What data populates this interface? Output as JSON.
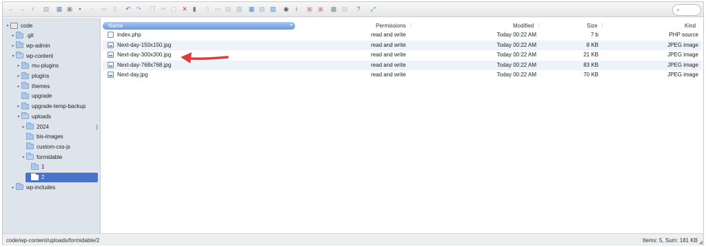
{
  "toolbar": {
    "buttons": [
      {
        "name": "back-icon",
        "glyph": "←",
        "color": "#7aa6d8"
      },
      {
        "name": "forward-icon",
        "glyph": "→",
        "color": "#7aa6d8"
      },
      {
        "name": "up-icon",
        "glyph": "↑",
        "color": "#4a86c8"
      },
      {
        "name": "reload-icon",
        "glyph": "▤",
        "color": "#9aa3ad"
      },
      {
        "name": "open-icon",
        "glyph": "▦",
        "color": "#6b8bb0"
      },
      {
        "name": "download-icon",
        "glyph": "▣",
        "color": "#7f9f7f"
      },
      {
        "name": "save-icon",
        "glyph": "▪",
        "color": "#5f6f80"
      },
      {
        "name": "new-folder-icon",
        "glyph": "▫",
        "color": "#b0b8c0"
      },
      {
        "name": "new-file-icon",
        "glyph": "▭",
        "color": "#b0b8c0"
      },
      {
        "name": "upload-icon",
        "glyph": "▯",
        "color": "#b0b8c0"
      },
      {
        "name": "undo-icon",
        "glyph": "↶",
        "color": "#4f7fb8"
      },
      {
        "name": "redo-icon",
        "glyph": "↷",
        "color": "#9aa6b2"
      },
      {
        "name": "copy-icon",
        "glyph": "❐",
        "color": "#b7c2cc"
      },
      {
        "name": "cut-icon",
        "glyph": "✂",
        "color": "#b7c2cc"
      },
      {
        "name": "paste-icon",
        "glyph": "▢",
        "color": "#b7c2cc"
      },
      {
        "name": "delete-icon",
        "glyph": "✕",
        "color": "#d04040"
      },
      {
        "name": "empty-icon",
        "glyph": "▮",
        "color": "#6f7a86"
      },
      {
        "name": "duplicate-icon",
        "glyph": "▯",
        "color": "#b7c2cc"
      },
      {
        "name": "rename-icon",
        "glyph": "▭",
        "color": "#b7c2cc"
      },
      {
        "name": "edit-icon",
        "glyph": "▤",
        "color": "#b7c2cc"
      },
      {
        "name": "archive-icon",
        "glyph": "▧",
        "color": "#9fb3c8"
      },
      {
        "name": "icons-view-icon",
        "glyph": "▦",
        "color": "#4f86c6"
      },
      {
        "name": "list-view-icon",
        "glyph": "▤",
        "color": "#9fb3c8"
      },
      {
        "name": "resize-icon",
        "glyph": "▨",
        "color": "#4f86c6"
      },
      {
        "name": "preview-icon",
        "glyph": "◉",
        "color": "#555555"
      },
      {
        "name": "info-icon",
        "glyph": "i",
        "color": "#3a78c8"
      },
      {
        "name": "extract-icon",
        "glyph": "▣",
        "color": "#c8a0a0"
      },
      {
        "name": "compress-icon",
        "glyph": "▣",
        "color": "#c8a0a0"
      },
      {
        "name": "grid-icon",
        "glyph": "▩",
        "color": "#808890"
      },
      {
        "name": "sort-icon",
        "glyph": "▤",
        "color": "#b7c2cc"
      },
      {
        "name": "help-icon",
        "glyph": "?",
        "color": "#3a78c8"
      },
      {
        "name": "fullscreen-icon",
        "glyph": "⤢",
        "color": "#3aa060"
      }
    ],
    "search_glyph": "⌕"
  },
  "tree": {
    "items": [
      {
        "label": "code",
        "level": 0,
        "arrow": "▾",
        "icon": "drive",
        "selected": false
      },
      {
        "label": ".git",
        "level": 1,
        "arrow": "▸",
        "icon": "folder",
        "selected": false
      },
      {
        "label": "wp-admin",
        "level": 1,
        "arrow": "▸",
        "icon": "folder",
        "selected": false
      },
      {
        "label": "wp-content",
        "level": 1,
        "arrow": "▾",
        "icon": "folder-open",
        "selected": false
      },
      {
        "label": "mu-plugins",
        "level": 2,
        "arrow": "▸",
        "icon": "folder",
        "selected": false
      },
      {
        "label": "plugins",
        "level": 2,
        "arrow": "▸",
        "icon": "folder",
        "selected": false
      },
      {
        "label": "themes",
        "level": 2,
        "arrow": "▸",
        "icon": "folder",
        "selected": false
      },
      {
        "label": "upgrade",
        "level": 2,
        "arrow": "",
        "icon": "folder",
        "selected": false
      },
      {
        "label": "upgrade-temp-backup",
        "level": 2,
        "arrow": "▸",
        "icon": "folder",
        "selected": false
      },
      {
        "label": "uploads",
        "level": 2,
        "arrow": "▾",
        "icon": "folder-open",
        "selected": false
      },
      {
        "label": "2024",
        "level": 3,
        "arrow": "▸",
        "icon": "folder",
        "selected": false
      },
      {
        "label": "bis-images",
        "level": 3,
        "arrow": "",
        "icon": "folder",
        "selected": false
      },
      {
        "label": "custom-css-js",
        "level": 3,
        "arrow": "",
        "icon": "folder",
        "selected": false
      },
      {
        "label": "formidable",
        "level": 3,
        "arrow": "▾",
        "icon": "folder-open",
        "selected": false
      },
      {
        "label": "1",
        "level": 4,
        "arrow": "",
        "icon": "folder",
        "selected": false
      },
      {
        "label": "2",
        "level": 4,
        "arrow": "",
        "icon": "folder",
        "selected": true
      },
      {
        "label": "wp-includes",
        "level": 1,
        "arrow": "▸",
        "icon": "folder",
        "selected": false
      }
    ]
  },
  "list": {
    "headers": {
      "name": "Name",
      "permissions": "Permissions",
      "modified": "Modified",
      "size": "Size",
      "kind": "Kind"
    },
    "sort_glyph": "▾",
    "sep_glyph": "⁞",
    "rows": [
      {
        "name": "index.php",
        "permissions": "read and write",
        "modified": "Today 00:22 AM",
        "size": "7 b",
        "kind": "PHP source",
        "type": "php"
      },
      {
        "name": "Next-day-150x150.jpg",
        "permissions": "read and write",
        "modified": "Today 00:22 AM",
        "size": "8 KB",
        "kind": "JPEG image",
        "type": "img"
      },
      {
        "name": "Next-day-300x300.jpg",
        "permissions": "read and write",
        "modified": "Today 00:22 AM",
        "size": "21 KB",
        "kind": "JPEG image",
        "type": "img"
      },
      {
        "name": "Next-day-768x768.jpg",
        "permissions": "read and write",
        "modified": "Today 00:22 AM",
        "size": "83 KB",
        "kind": "JPEG image",
        "type": "img"
      },
      {
        "name": "Next-day.jpg",
        "permissions": "read and write",
        "modified": "Today 00:22 AM",
        "size": "70 KB",
        "kind": "JPEG image",
        "type": "img"
      }
    ]
  },
  "annotation": {
    "arrow_color": "#e03a3a"
  },
  "status": {
    "path": "code/wp-content/uploads/formidable/2",
    "summary": "Items: 5, Sum: 181 KB",
    "grip": "◢"
  }
}
